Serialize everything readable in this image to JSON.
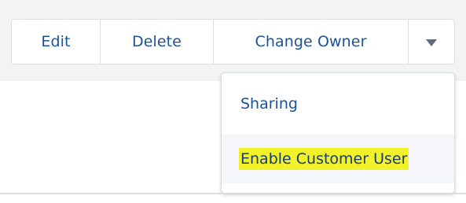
{
  "actions": {
    "edit_label": "Edit",
    "delete_label": "Delete",
    "change_owner_label": "Change Owner",
    "more_icon": "caret-down-icon"
  },
  "menu": {
    "items": [
      {
        "label": "Sharing"
      },
      {
        "label": "Enable Customer User",
        "highlighted": true
      }
    ]
  },
  "colors": {
    "link": "#1b5297",
    "highlight": "#f2f22a",
    "hover_bg": "#f4f6f9"
  }
}
